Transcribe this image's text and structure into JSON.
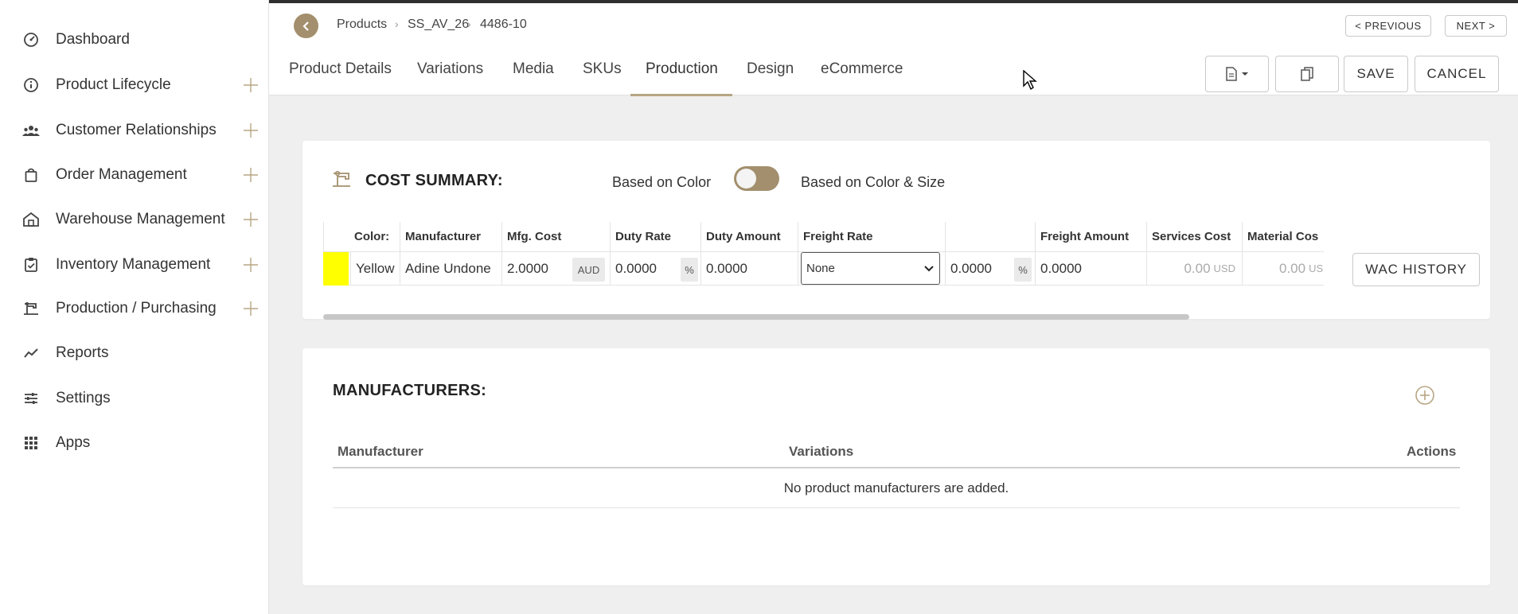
{
  "sidebar": {
    "items": [
      {
        "label": "Dashboard",
        "icon": "dashboard-gauge-icon",
        "expandable": false
      },
      {
        "label": "Product Lifecycle",
        "icon": "info-circle-icon",
        "expandable": true
      },
      {
        "label": "Customer Relationships",
        "icon": "people-icon",
        "expandable": true
      },
      {
        "label": "Order Management",
        "icon": "shopping-bag-icon",
        "expandable": true
      },
      {
        "label": "Warehouse Management",
        "icon": "warehouse-icon",
        "expandable": true
      },
      {
        "label": "Inventory Management",
        "icon": "clipboard-check-icon",
        "expandable": true
      },
      {
        "label": "Production / Purchasing",
        "icon": "sewing-machine-icon",
        "expandable": true
      },
      {
        "label": "Reports",
        "icon": "line-chart-icon",
        "expandable": false
      },
      {
        "label": "Settings",
        "icon": "sliders-icon",
        "expandable": false
      },
      {
        "label": "Apps",
        "icon": "grid-icon",
        "expandable": false
      }
    ]
  },
  "breadcrumb": [
    "Products",
    "SS_AV_26",
    "4486-10"
  ],
  "pager": {
    "previous": "< PREVIOUS",
    "next": "NEXT >"
  },
  "tabs": [
    {
      "label": "Product Details"
    },
    {
      "label": "Variations"
    },
    {
      "label": "Media"
    },
    {
      "label": "SKUs"
    },
    {
      "label": "Production",
      "active": true
    },
    {
      "label": "Design"
    },
    {
      "label": "eCommerce"
    }
  ],
  "actions": {
    "save": "SAVE",
    "cancel": "CANCEL"
  },
  "cost_summary": {
    "title": "COST SUMMARY:",
    "toggle_left": "Based on Color",
    "toggle_right": "Based on Color & Size",
    "toggle_on": false,
    "columns": [
      "Color:",
      "Manufacturer",
      "Mfg. Cost",
      "Duty Rate",
      "Duty Amount",
      "Freight Rate",
      "",
      "Freight Amount",
      "Services Cost",
      "Material Cos"
    ],
    "row": {
      "swatch_color": "#ffff00",
      "color": "Yellow",
      "manufacturer": "Adine Undone",
      "mfg_cost": "2.0000",
      "mfg_currency": "AUD",
      "duty_rate": "0.0000",
      "duty_unit": "%",
      "duty_amount": "0.0000",
      "freight_rate_select": "None",
      "freight_pct": "0.0000",
      "freight_pct_unit": "%",
      "freight_amount": "0.0000",
      "services_cost": "0.00",
      "services_currency": "USD",
      "material_cost": "0.00",
      "material_currency": "US"
    },
    "wac_button": "WAC HISTORY"
  },
  "manufacturers": {
    "title": "MANUFACTURERS:",
    "columns": [
      "Manufacturer",
      "Variations",
      "Actions"
    ],
    "empty_message": "No product manufacturers are added."
  },
  "colors": {
    "accent": "#b7a583",
    "back_button": "#a38f6d",
    "toggle_track": "#a38f6d"
  }
}
